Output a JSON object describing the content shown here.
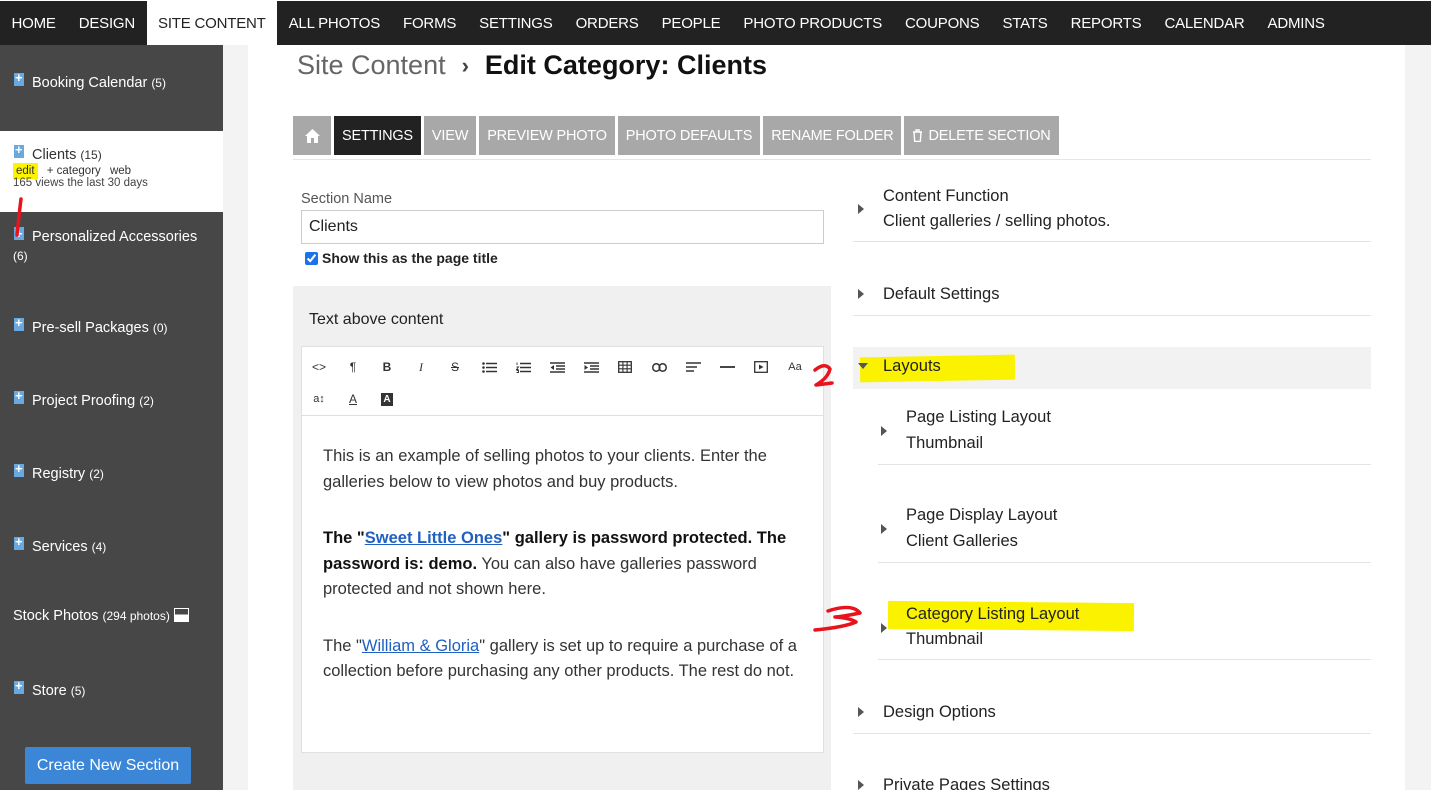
{
  "topnav": {
    "items": [
      {
        "label": "HOME"
      },
      {
        "label": "DESIGN"
      },
      {
        "label": "SITE CONTENT",
        "active": true
      },
      {
        "label": "ALL PHOTOS"
      },
      {
        "label": "FORMS"
      },
      {
        "label": "SETTINGS"
      },
      {
        "label": "ORDERS"
      },
      {
        "label": "PEOPLE"
      },
      {
        "label": "PHOTO PRODUCTS"
      },
      {
        "label": "COUPONS"
      },
      {
        "label": "STATS"
      },
      {
        "label": "REPORTS"
      },
      {
        "label": "CALENDAR"
      },
      {
        "label": "ADMINS"
      }
    ]
  },
  "sidebar": {
    "items": [
      {
        "label": "Booking Calendar",
        "count": "(5)"
      },
      {
        "label": "Clients",
        "count": "(15)",
        "active": true,
        "links": [
          "edit",
          "+ category",
          "web"
        ],
        "views": "165 views the last 30 days"
      },
      {
        "label": "Personalized Accessories",
        "count": "(6)"
      },
      {
        "label": "Pre-sell Packages",
        "count": "(0)"
      },
      {
        "label": "Project Proofing",
        "count": "(2)"
      },
      {
        "label": "Registry",
        "count": "(2)"
      },
      {
        "label": "Services",
        "count": "(4)"
      },
      {
        "label": "Stock Photos",
        "count": "(294 photos)"
      },
      {
        "label": "Store",
        "count": "(5)"
      }
    ],
    "create_button": "Create New Section"
  },
  "breadcrumb": {
    "parent": "Site Content",
    "current": "Edit Category: Clients"
  },
  "tabs": {
    "settings": "SETTINGS",
    "view": "VIEW",
    "preview_photo": "PREVIEW PHOTO",
    "photo_defaults": "PHOTO DEFAULTS",
    "rename_folder": "RENAME FOLDER",
    "delete_section": "DELETE SECTION"
  },
  "form": {
    "section_name_label": "Section Name",
    "section_name_value": "Clients",
    "show_title_label": "Show this as the page title",
    "show_title_checked": true
  },
  "editor": {
    "title": "Text above content",
    "toolbar": {
      "row1": [
        "<>",
        "¶",
        "B",
        "I",
        "S",
        "bullet-list-icon",
        "numbered-list-icon",
        "outdent-icon",
        "indent-icon",
        "table-icon",
        "link-icon",
        "align-icon",
        "horizontal-rule-icon",
        "video-icon",
        "Aa"
      ],
      "row2": [
        "a↕",
        "A",
        "A"
      ]
    },
    "p1": "This is an example of selling photos to your clients. Enter the galleries below to view photos and buy products.",
    "p2_a": "The \"",
    "p2_link": "Sweet Little Ones",
    "p2_b": "\" gallery is password protected. The password is: demo.",
    "p2_c": " You can also have galleries password protected and not shown here.",
    "p3_a": "The \"",
    "p3_link": "William & Gloria",
    "p3_b": "\" gallery is set up to require a purchase of a collection before purchasing any other products. The rest do not."
  },
  "right_panel": {
    "content_function": {
      "title": "Content Function",
      "value": "Client galleries / selling photos."
    },
    "default_settings": {
      "title": "Default Settings"
    },
    "layouts": {
      "title": "Layouts"
    },
    "page_listing_layout": {
      "title": "Page Listing Layout",
      "value": "Thumbnail"
    },
    "page_display_layout": {
      "title": "Page Display Layout",
      "value": "Client Galleries"
    },
    "category_listing_layout": {
      "title": "Category Listing Layout",
      "value": "Thumbnail"
    },
    "design_options": {
      "title": "Design Options"
    },
    "private_pages_settings": {
      "title": "Private Pages Settings"
    }
  },
  "colors": {
    "nav_bg": "#222222",
    "sidebar_bg": "#474747",
    "tab_bg": "#a8a8a8",
    "tab_active": "#222222",
    "create_button": "#3b86d6",
    "highlight": "#fbf200",
    "annotation_red": "#e8141c"
  }
}
